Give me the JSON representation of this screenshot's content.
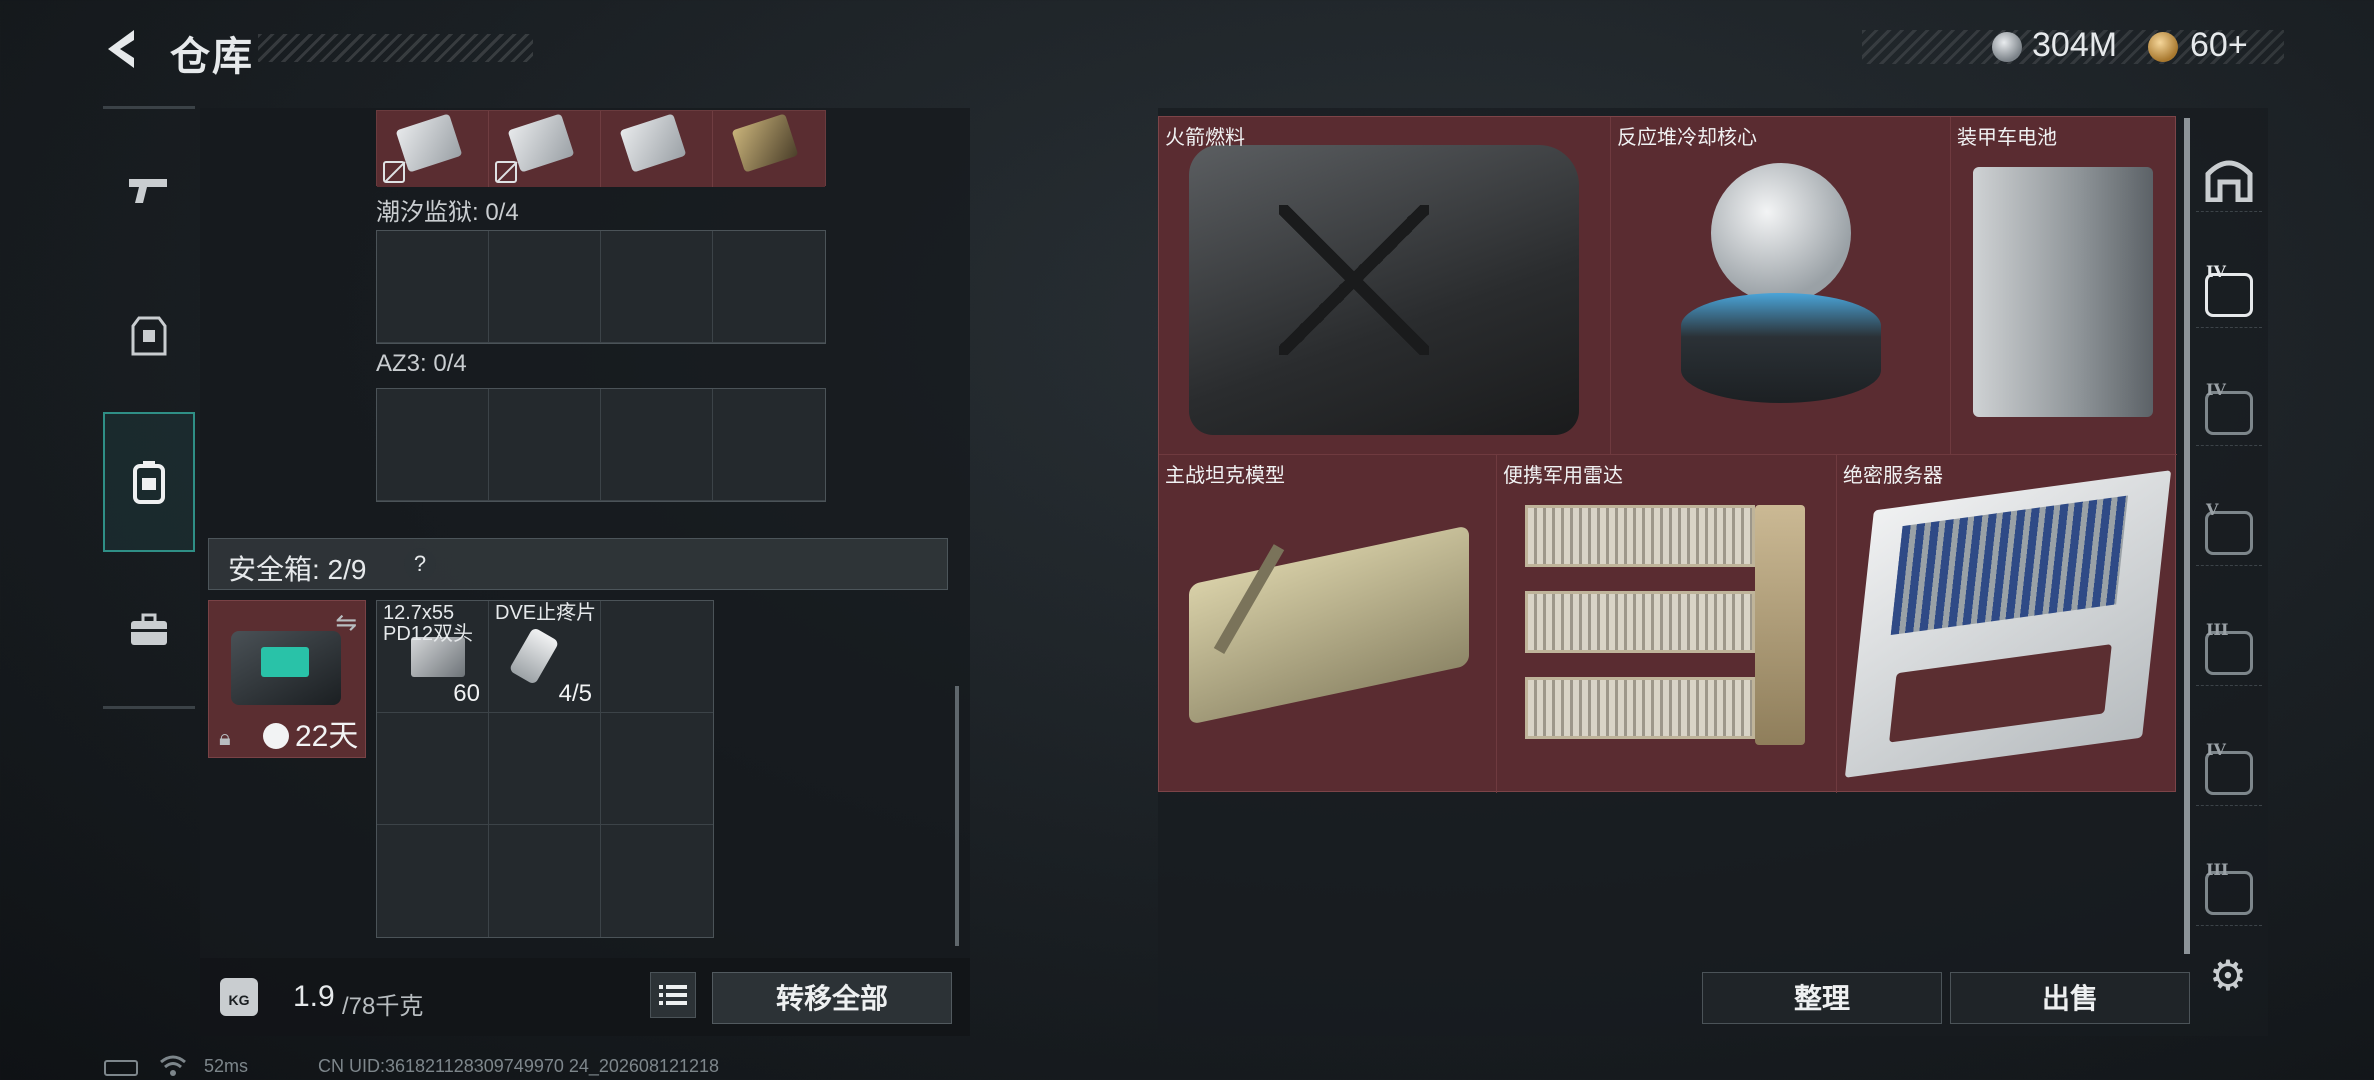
{
  "header": {
    "title": "仓库",
    "currency": {
      "silver_value": "304M",
      "gold_value": "60+"
    }
  },
  "left_panel": {
    "sections": [
      {
        "label": "潮汐监狱: 0/4"
      },
      {
        "label": "AZ3: 0/4"
      }
    ],
    "safe_box": {
      "label": "安全箱: 2/9",
      "help": "?",
      "remaining_time": "22天",
      "items": [
        {
          "name": "12.7x55 PD12双头",
          "count": "60"
        },
        {
          "name": "DVE止疼片",
          "count": "4/5"
        }
      ]
    },
    "weight": {
      "current": "1.9",
      "max": "/78千克",
      "icon_text": "KG"
    },
    "transfer_all_label": "转移全部"
  },
  "stash": {
    "items": [
      {
        "name": "火箭燃料"
      },
      {
        "name": "反应堆冷却核心"
      },
      {
        "name": "装甲车电池"
      },
      {
        "name": "主战坦克模型"
      },
      {
        "name": "便携军用雷达"
      },
      {
        "name": "绝密服务器"
      }
    ]
  },
  "side_tabs": [
    "IV",
    "IV",
    "V",
    "III",
    "IV",
    "III"
  ],
  "actions": {
    "sort_label": "整理",
    "sell_label": "出售"
  },
  "status_bar": {
    "ping": "52ms",
    "uid": "CN UID:361821128309749970 24_202608121218"
  },
  "colors": {
    "rare_red": "#5a2c31",
    "accent_teal": "#2f8f86"
  }
}
